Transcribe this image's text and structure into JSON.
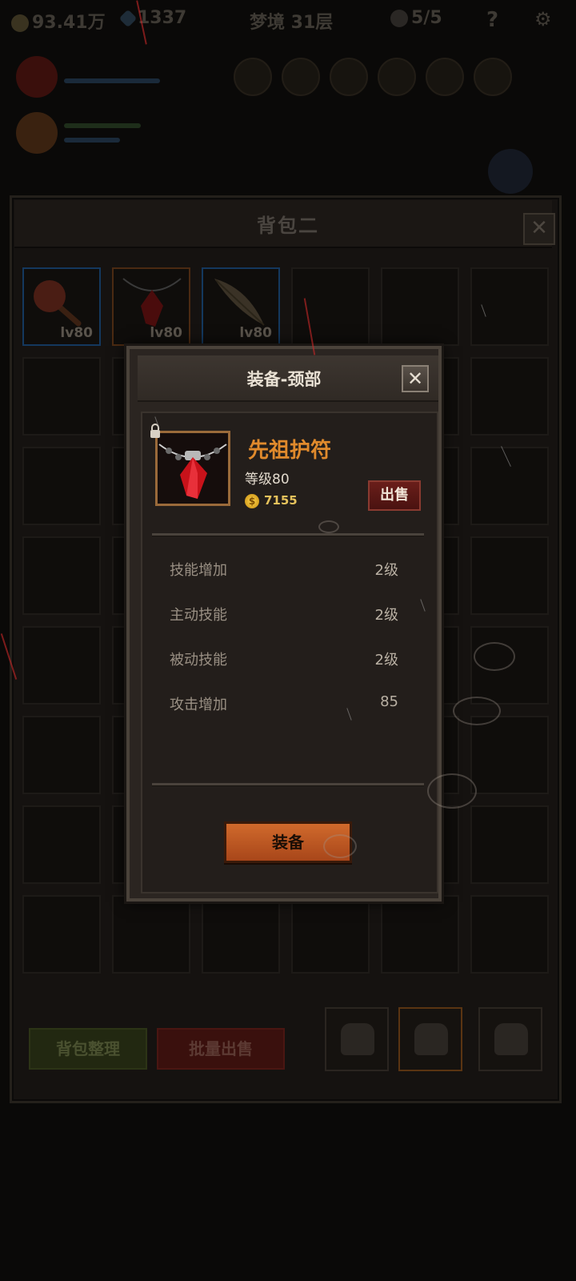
{
  "topbar": {
    "gold": "93.41万",
    "gems": "1337",
    "stage": "梦境 31层",
    "lives": "5/5",
    "help_icon": "question-icon",
    "settings_icon": "gear-icon"
  },
  "backpack": {
    "title": "背包二",
    "close_label": "✕",
    "items": [
      {
        "icon": "mace-icon",
        "level": "lv80",
        "rarity_color": "#14385e"
      },
      {
        "icon": "amulet-icon",
        "level": "lv80",
        "rarity_color": "#4b2a12"
      },
      {
        "icon": "feather-icon",
        "level": "lv80",
        "rarity_color": "#14385e"
      }
    ],
    "sort_button": "背包整理",
    "batch_sell_button": "批量出售"
  },
  "modal": {
    "title": "装备-颈部",
    "close_label": "✕",
    "item_name": "先祖护符",
    "item_level": "等级80",
    "price": "7155",
    "coin_symbol": "$",
    "sell_button": "出售",
    "stats": [
      {
        "label": "技能增加",
        "value": "2级"
      },
      {
        "label": "主动技能",
        "value": "2级"
      },
      {
        "label": "被动技能",
        "value": "2级"
      },
      {
        "label": "攻击增加",
        "value": "85"
      }
    ],
    "equip_button": "装备"
  },
  "colors": {
    "item_name": "#e08a2c",
    "equip_button": "#c25e26",
    "sell_button": "#5a1815",
    "price": "#e7c35c"
  }
}
